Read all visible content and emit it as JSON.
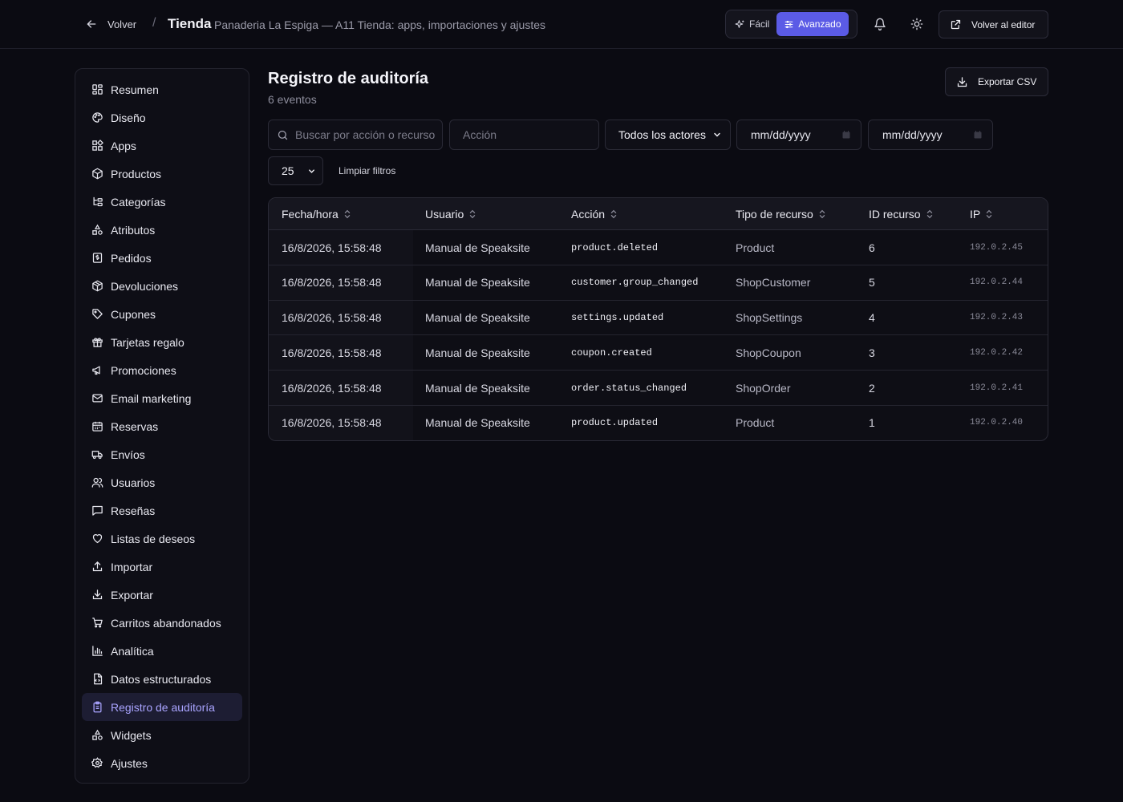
{
  "header": {
    "back_label": "Volver",
    "separator": "/",
    "title": "Tienda",
    "subtitle": "Panaderia La Espiga — A11 Tienda: apps, importaciones y ajustes",
    "modes": [
      {
        "label": "Fácil",
        "active": false
      },
      {
        "label": "Avanzado",
        "active": true
      }
    ],
    "editor_label": "Volver al editor",
    "accent_color": "#5b5be6"
  },
  "sidebar": {
    "items": [
      {
        "label": "Resumen",
        "icon": "grid-icon"
      },
      {
        "label": "Diseño",
        "icon": "palette-icon"
      },
      {
        "label": "Apps",
        "icon": "apps-icon"
      },
      {
        "label": "Productos",
        "icon": "box-icon"
      },
      {
        "label": "Categorías",
        "icon": "tree-icon"
      },
      {
        "label": "Atributos",
        "icon": "shapes-icon"
      },
      {
        "label": "Pedidos",
        "icon": "receipt-icon"
      },
      {
        "label": "Devoluciones",
        "icon": "package-return-icon"
      },
      {
        "label": "Cupones",
        "icon": "tag-icon"
      },
      {
        "label": "Tarjetas regalo",
        "icon": "gift-icon"
      },
      {
        "label": "Promociones",
        "icon": "megaphone-icon"
      },
      {
        "label": "Email marketing",
        "icon": "mail-icon"
      },
      {
        "label": "Reservas",
        "icon": "calendar-icon"
      },
      {
        "label": "Envíos",
        "icon": "truck-icon"
      },
      {
        "label": "Usuarios",
        "icon": "users-icon"
      },
      {
        "label": "Reseñas",
        "icon": "message-icon"
      },
      {
        "label": "Listas de deseos",
        "icon": "heart-icon"
      },
      {
        "label": "Importar",
        "icon": "upload-icon"
      },
      {
        "label": "Exportar",
        "icon": "download-icon"
      },
      {
        "label": "Carritos abandonados",
        "icon": "cart-icon"
      },
      {
        "label": "Analítica",
        "icon": "bar-chart-icon"
      },
      {
        "label": "Datos estructurados",
        "icon": "file-code-icon"
      },
      {
        "label": "Registro de auditoría",
        "icon": "clipboard-icon",
        "active": true
      },
      {
        "label": "Widgets",
        "icon": "widgets-icon"
      },
      {
        "label": "Ajustes",
        "icon": "gear-icon"
      }
    ]
  },
  "main": {
    "title": "Registro de auditoría",
    "subtitle": "6 eventos",
    "export_label": "Exportar CSV"
  },
  "filters": {
    "search_placeholder": "Buscar por acción o recurso",
    "action_placeholder": "Acción",
    "actor_selected": "Todos los actores",
    "date_from": "mm/dd/yyyy",
    "date_to": "mm/dd/yyyy",
    "page_size": "25",
    "clear_label": "Limpiar filtros"
  },
  "table": {
    "columns": [
      "Fecha/hora",
      "Usuario",
      "Acción",
      "Tipo de recurso",
      "ID recurso",
      "IP"
    ],
    "rows": [
      {
        "date": "16/8/2026, 15:58:48",
        "user": "Manual de Speaksite",
        "action": "product.deleted",
        "type": "Product",
        "id": "6",
        "ip": "192.0.2.45"
      },
      {
        "date": "16/8/2026, 15:58:48",
        "user": "Manual de Speaksite",
        "action": "customer.group_changed",
        "type": "ShopCustomer",
        "id": "5",
        "ip": "192.0.2.44"
      },
      {
        "date": "16/8/2026, 15:58:48",
        "user": "Manual de Speaksite",
        "action": "settings.updated",
        "type": "ShopSettings",
        "id": "4",
        "ip": "192.0.2.43"
      },
      {
        "date": "16/8/2026, 15:58:48",
        "user": "Manual de Speaksite",
        "action": "coupon.created",
        "type": "ShopCoupon",
        "id": "3",
        "ip": "192.0.2.42"
      },
      {
        "date": "16/8/2026, 15:58:48",
        "user": "Manual de Speaksite",
        "action": "order.status_changed",
        "type": "ShopOrder",
        "id": "2",
        "ip": "192.0.2.41"
      },
      {
        "date": "16/8/2026, 15:58:48",
        "user": "Manual de Speaksite",
        "action": "product.updated",
        "type": "Product",
        "id": "1",
        "ip": "192.0.2.40"
      }
    ]
  }
}
